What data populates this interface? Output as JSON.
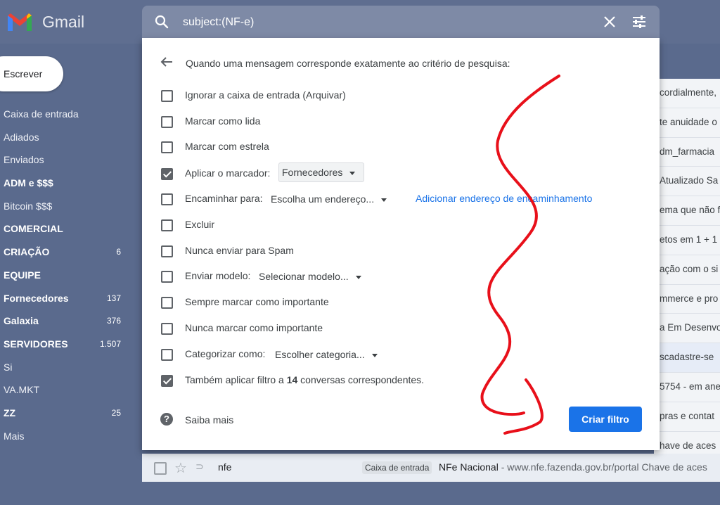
{
  "app": {
    "name": "Gmail"
  },
  "sidebar": {
    "compose_label": "Escrever",
    "items": [
      {
        "label": "Caixa de entrada",
        "count": "",
        "bold": false
      },
      {
        "label": "Adiados",
        "count": "",
        "bold": false
      },
      {
        "label": "Enviados",
        "count": "",
        "bold": false
      },
      {
        "label": "ADM e $$$",
        "count": "",
        "bold": true
      },
      {
        "label": "Bitcoin $$$",
        "count": "",
        "bold": false
      },
      {
        "label": "COMERCIAL",
        "count": "",
        "bold": true
      },
      {
        "label": "CRIAÇÃO",
        "count": "6",
        "bold": true
      },
      {
        "label": "EQUIPE",
        "count": "",
        "bold": true
      },
      {
        "label": "Fornecedores",
        "count": "137",
        "bold": true
      },
      {
        "label": "Galaxia",
        "count": "376",
        "bold": true
      },
      {
        "label": "SERVIDORES",
        "count": "1.507",
        "bold": true
      },
      {
        "label": "Si",
        "count": "",
        "bold": false
      },
      {
        "label": "VA.MKT",
        "count": "",
        "bold": false
      },
      {
        "label": "ZZ",
        "count": "25",
        "bold": true
      },
      {
        "label": "Mais",
        "count": "",
        "bold": false
      }
    ]
  },
  "search": {
    "value": "subject:(NF-e)"
  },
  "filter": {
    "header": "Quando uma mensagem corresponde exatamente ao critério de pesquisa:",
    "options": {
      "archive": {
        "label": "Ignorar a caixa de entrada (Arquivar)",
        "checked": false
      },
      "mark_read": {
        "label": "Marcar como lida",
        "checked": false
      },
      "star": {
        "label": "Marcar com estrela",
        "checked": false
      },
      "apply_label": {
        "label": "Aplicar o marcador:",
        "checked": true,
        "value": "Fornecedores"
      },
      "forward": {
        "label": "Encaminhar para:",
        "checked": false,
        "value": "Escolha um endereço...",
        "link": "Adicionar endereço de encaminhamento"
      },
      "delete": {
        "label": "Excluir",
        "checked": false
      },
      "never_spam": {
        "label": "Nunca enviar para Spam",
        "checked": false
      },
      "send_template": {
        "label": "Enviar modelo:",
        "checked": false,
        "value": "Selecionar modelo..."
      },
      "always_important": {
        "label": "Sempre marcar como importante",
        "checked": false
      },
      "never_important": {
        "label": "Nunca marcar como importante",
        "checked": false
      },
      "categorize": {
        "label": "Categorizar como:",
        "checked": false,
        "value": "Escolher categoria..."
      }
    },
    "also_apply": {
      "prefix": "Também aplicar filtro a ",
      "count": "14",
      "suffix": " conversas correspondentes.",
      "checked": true
    },
    "learn_more": "Saiba mais",
    "create_button": "Criar filtro"
  },
  "mail_list_fragments": [
    "cordialmente,",
    "te anuidade o",
    "dm_farmacia",
    "Atualizado Sa",
    "ema que não f",
    "etos em 1 + 1",
    "ação com o si",
    "mmerce e pro",
    "a Em Desenvo",
    "scadastre-se",
    "5754 - em ane",
    "pras e contat",
    "have de aces"
  ],
  "bottom_row": {
    "sender": "nfe",
    "label": "Caixa de entrada",
    "subject": "NFe Nacional",
    "snippet": " - www.nfe.fazenda.gov.br/portal Chave de aces"
  },
  "colors": {
    "sidebar_bg": "#5a6a8d",
    "search_bar": "#7e8aa6",
    "primary_button": "#1a73e8",
    "link": "#1a73e8",
    "annotation_stroke": "#e8101a"
  },
  "icons": {
    "search": "search-icon",
    "close": "close-icon",
    "filter_options": "tune-icon",
    "back": "arrow-back-icon",
    "help": "help-icon",
    "star": "star-icon",
    "importance": "importance-marker-icon"
  }
}
